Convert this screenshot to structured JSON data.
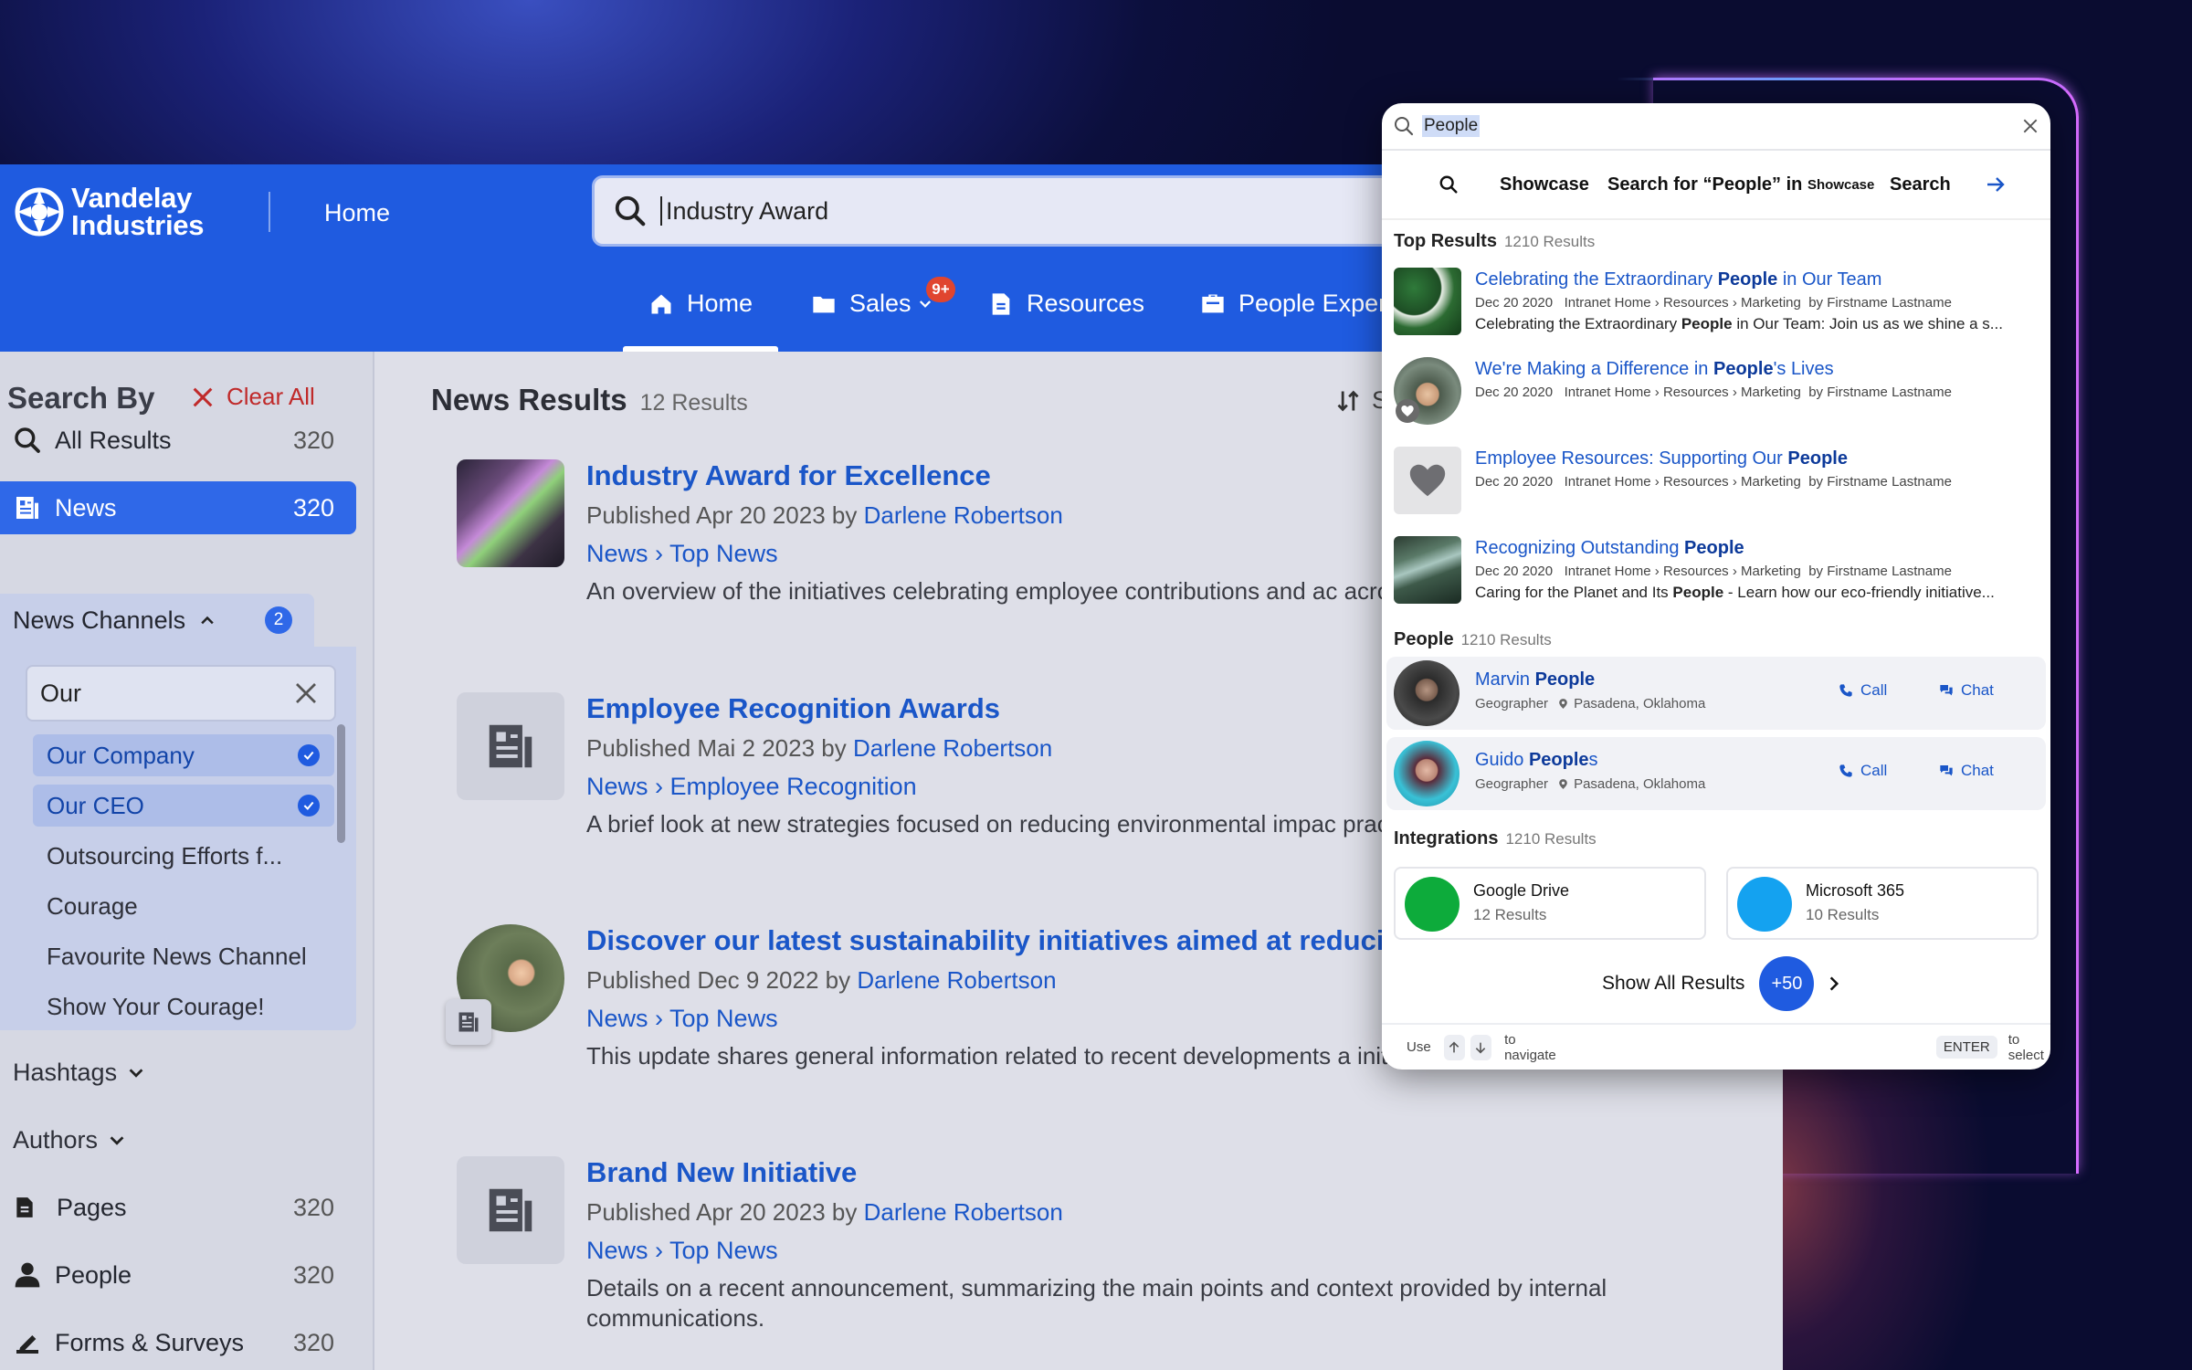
{
  "brand": {
    "line1": "Vandelay",
    "line2": "Industries",
    "home_label": "Home"
  },
  "main_search": {
    "value": "Industry Award"
  },
  "nav": {
    "items": [
      {
        "label": "Home",
        "icon": "home-icon",
        "active": true
      },
      {
        "label": "Sales",
        "icon": "folder-icon",
        "badge": "9+"
      },
      {
        "label": "Resources",
        "icon": "document-icon"
      },
      {
        "label": "People Experi",
        "icon": "briefcase-icon"
      }
    ]
  },
  "sidebar": {
    "title": "Search By",
    "clear_label": "Clear All",
    "all": {
      "label": "All Results",
      "count": "320"
    },
    "news": {
      "label": "News",
      "count": "320"
    },
    "channels_label": "News Channels",
    "channels_count": "2",
    "channel_filter_value": "Our",
    "channels": [
      {
        "label": "Our Company",
        "selected": true
      },
      {
        "label": "Our CEO",
        "selected": true
      },
      {
        "label": "Outsourcing Efforts f...",
        "selected": false
      },
      {
        "label": "Courage",
        "selected": false
      },
      {
        "label": "Favourite News Channel",
        "selected": false
      },
      {
        "label": "Show Your Courage!",
        "selected": false
      }
    ],
    "hashtags_label": "Hashtags",
    "authors_label": "Authors",
    "pages": {
      "label": "Pages",
      "count": "320"
    },
    "people": {
      "label": "People",
      "count": "320"
    },
    "forms": {
      "label": "Forms & Surveys",
      "count": "320"
    }
  },
  "results": {
    "title": "News Results",
    "count": "12 Results",
    "sort_label": "S",
    "items": [
      {
        "title": "Industry Award for Excellence",
        "published": "Published Apr 20 2023 by",
        "author": "Darlene Robertson",
        "crumb": "News › Top News",
        "desc": "An overview of the initiatives celebrating employee contributions and ac across departments."
      },
      {
        "title": "Employee Recognition Awards",
        "published": "Published Mai 2 2023 by",
        "author": "Darlene Robertson",
        "crumb": "News ›  Employee Recognition",
        "desc": "A brief look at new strategies focused on reducing environmental impac practices."
      },
      {
        "title": "Discover our latest sustainability initiatives aimed at reducing",
        "published": "Published Dec 9 2022 by",
        "author": "Darlene Robertson",
        "crumb": "News › Top News",
        "desc": "This update shares general information related to recent developments a initiatives."
      },
      {
        "title": "Brand New Initiative",
        "published": "Published Apr 20 2023 by",
        "author": "Darlene Robertson",
        "crumb": "News › Top News",
        "desc": "Details on a recent announcement, summarizing the main points and context provided by internal communications."
      }
    ]
  },
  "popup": {
    "query": "People",
    "showcase": {
      "t1": "Showcase",
      "t2": "Search for “People” in",
      "t3": "Showcase",
      "t4": "Search"
    },
    "top_results": {
      "label": "Top Results",
      "count": "1210 Results",
      "items": [
        {
          "pre": "Celebrating the Extraordinary ",
          "hl": "People",
          "post": " in Our Team",
          "date": "Dec 20 2020",
          "path": "Intranet Home › Resources › Marketing",
          "by": "by",
          "author": "Firstname Lastname",
          "desc_pre": "Celebrating the Extraordinary ",
          "desc_hl": "People",
          "desc_post": " in Our Team: Join us as we shine a s..."
        },
        {
          "pre": "We're Making a Difference in ",
          "hl": "People",
          "post": "'s Lives",
          "date": "Dec 20 2020",
          "path": "Intranet Home › Resources › Marketing",
          "by": "by",
          "author": "Firstname Lastname"
        },
        {
          "pre": "Employee Resources: Supporting Our ",
          "hl": "People",
          "post": "",
          "date": "Dec 20 2020",
          "path": "Intranet Home › Resources › Marketing",
          "by": "by",
          "author": "Firstname Lastname"
        },
        {
          "pre": "Recognizing Outstanding ",
          "hl": "People",
          "post": "",
          "date": "Dec 20 2020",
          "path": "Intranet Home › Resources › Marketing",
          "by": "by",
          "author": "Firstname Lastname",
          "desc_pre": " Caring for the Planet and Its ",
          "desc_hl": "People",
          "desc_post": " - Learn how our eco-friendly initiative..."
        }
      ]
    },
    "people": {
      "label": "People",
      "count": "1210 Results",
      "items": [
        {
          "first": "Marvin ",
          "hl": "People",
          "post": "",
          "role": "Geographer",
          "location": "Pasadena, Oklahoma",
          "call": "Call",
          "chat": "Chat"
        },
        {
          "first": "Guido ",
          "hl": "People",
          "post": "s",
          "role": "Geographer",
          "location": "Pasadena, Oklahoma",
          "call": "Call",
          "chat": "Chat"
        }
      ]
    },
    "integrations": {
      "label": "Integrations",
      "count": "1210 Results",
      "items": [
        {
          "name": "Google Drive",
          "results": "12 Results",
          "color": "#0dab3b"
        },
        {
          "name": "Microsoft 365",
          "results": "10 Results",
          "color": "#14a2f0"
        }
      ]
    },
    "show_all": {
      "label": "Show All Results",
      "more": "+50"
    },
    "footer": {
      "use": "Use",
      "navigate": "to navigate",
      "enter": "ENTER",
      "select": "to select"
    }
  }
}
